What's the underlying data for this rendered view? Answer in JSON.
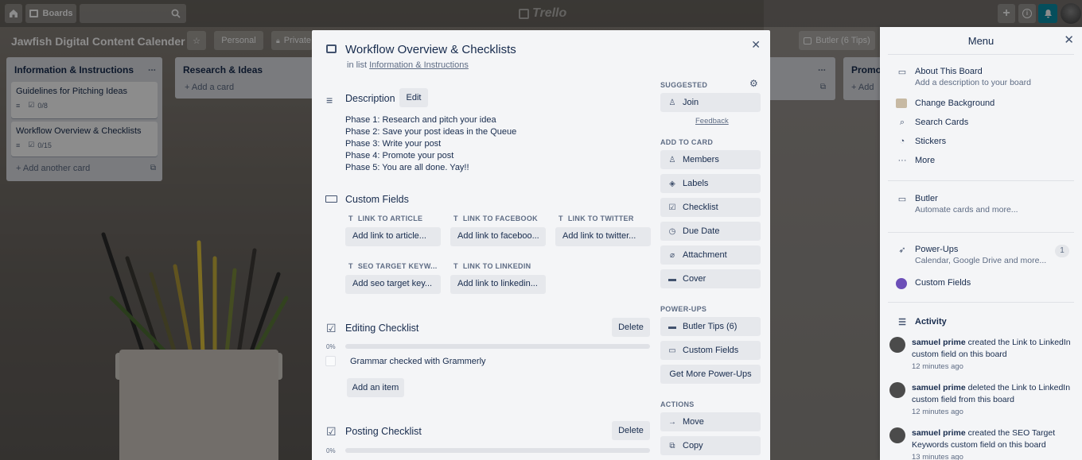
{
  "topbar": {
    "boards_label": "Boards",
    "logo": "Trello"
  },
  "board": {
    "title": "Jawfish Digital Content Calender",
    "visibility_personal": "Personal",
    "visibility_private": "Private",
    "butler_label": "Butler (6 Tips)"
  },
  "lists": [
    {
      "title": "Information & Instructions",
      "more": "...",
      "cards": [
        {
          "title": "Guidelines for Pitching Ideas",
          "checklist": "0/8"
        },
        {
          "title": "Workflow Overview & Checklists",
          "checklist": "0/15"
        }
      ],
      "add_label": "+ Add another card"
    },
    {
      "title": "Research & Ideas",
      "add_label": "+ Add a card"
    },
    {
      "title": "Promoti",
      "more": "...",
      "add_label": "+ Add"
    }
  ],
  "card": {
    "title": "Workflow Overview & Checklists",
    "in_list_prefix": "in list",
    "in_list_name": "Information & Instructions",
    "description_heading": "Description",
    "edit_label": "Edit",
    "description_lines": [
      "Phase 1: Research and pitch your idea",
      "Phase 2: Save your post ideas in the Queue",
      "Phase 3: Write your post",
      "Phase 4: Promote your post",
      "Phase 5: You are all done. Yay!!"
    ],
    "custom_fields_heading": "Custom Fields",
    "fields": [
      {
        "label": "LINK TO ARTICLE",
        "placeholder": "Add link to article..."
      },
      {
        "label": "LINK TO FACEBOOK",
        "placeholder": "Add link to faceboo..."
      },
      {
        "label": "LINK TO TWITTER",
        "placeholder": "Add link to twitter..."
      },
      {
        "label": "SEO TARGET KEYW...",
        "placeholder": "Add seo target key..."
      },
      {
        "label": "LINK TO LINKEDIN",
        "placeholder": "Add link to linkedin..."
      }
    ],
    "editing_checklist": {
      "title": "Editing Checklist",
      "delete_label": "Delete",
      "progress": "0%",
      "progress_value": 0,
      "items": [
        "Grammar checked with Grammerly"
      ],
      "add_item_label": "Add an item"
    },
    "posting_checklist": {
      "title": "Posting Checklist",
      "delete_label": "Delete",
      "progress": "0%",
      "progress_value": 0
    }
  },
  "sidebar": {
    "suggested": "SUGGESTED",
    "join": "Join",
    "feedback": "Feedback",
    "add_to_card": "ADD TO CARD",
    "add_items": [
      "Members",
      "Labels",
      "Checklist",
      "Due Date",
      "Attachment",
      "Cover"
    ],
    "powerups": "POWER-UPS",
    "powerup_items": [
      "Butler Tips (6)",
      "Custom Fields"
    ],
    "get_more": "Get More Power-Ups",
    "actions": "ACTIONS",
    "action_items": [
      "Move",
      "Copy"
    ]
  },
  "menu": {
    "title": "Menu",
    "about_title": "About This Board",
    "about_sub": "Add a description to your board",
    "change_bg": "Change Background",
    "search_cards": "Search Cards",
    "stickers": "Stickers",
    "more": "More",
    "butler_title": "Butler",
    "butler_sub": "Automate cards and more...",
    "powerups_title": "Power-Ups",
    "powerups_sub": "Calendar, Google Drive and more...",
    "powerups_count": "1",
    "custom_fields": "Custom Fields",
    "activity_title": "Activity",
    "activities": [
      {
        "user": "samuel prime",
        "text": " created the Link to LinkedIn custom field on this board",
        "time": "12 minutes ago"
      },
      {
        "user": "samuel prime",
        "text": " deleted the Link to LinkedIn custom field from this board",
        "time": "12 minutes ago"
      },
      {
        "user": "samuel prime",
        "text": " created the SEO Target Keywords custom field on this board",
        "time": "13 minutes ago"
      }
    ]
  }
}
